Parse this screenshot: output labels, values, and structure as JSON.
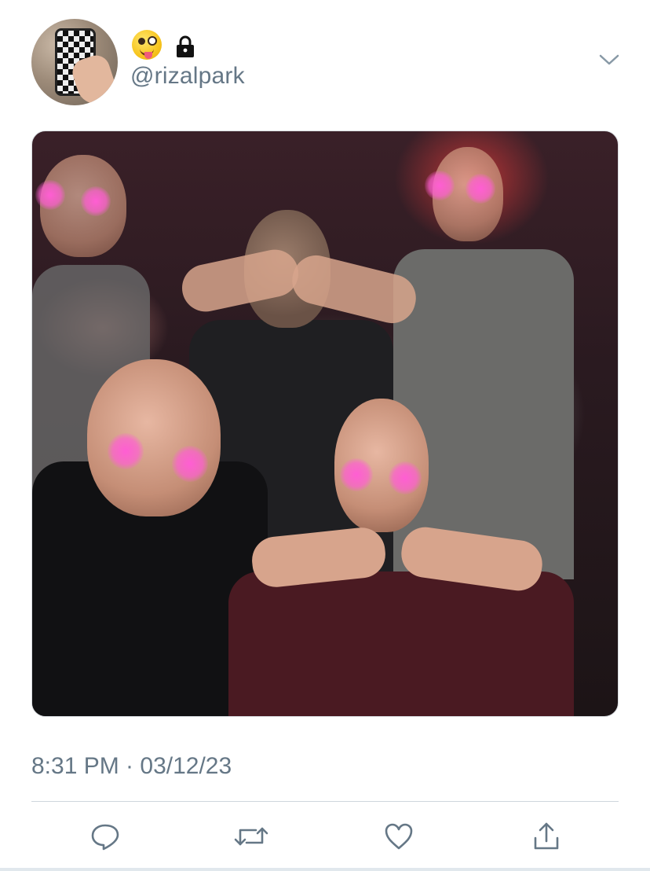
{
  "user": {
    "handle": "@rizalpark",
    "emoji_icon": "zany-face-icon",
    "lock_icon": "lock-icon",
    "avatar": "profile-photo"
  },
  "tweet": {
    "media_description_icon": "photo",
    "timestamp": "8:31 PM · 03/12/23"
  },
  "actions": [
    {
      "name": "reply-icon"
    },
    {
      "name": "retweet-icon"
    },
    {
      "name": "like-icon"
    },
    {
      "name": "share-icon"
    }
  ],
  "colors": {
    "secondary_text": "#657786",
    "icon": "#657786",
    "divider": "#cfd6dc"
  }
}
